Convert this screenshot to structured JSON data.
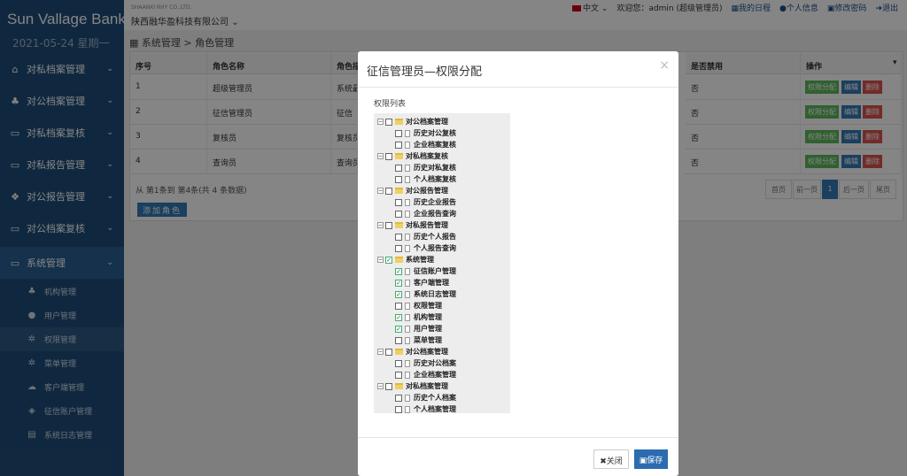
{
  "brand": "Sun Vallage Bank",
  "date": "2021-05-24 星期一",
  "company_small": "SHAANXI RHY CO.,LTD.",
  "company": "陕西融华盈科技有限公司",
  "top": {
    "lang": "中文",
    "welcome": "欢迎您：admin (超级管理员)",
    "schedule": "我的日程",
    "profile": "个人信息",
    "password": "修改密码",
    "logout": "退出"
  },
  "nav": [
    {
      "label": "对私档案管理",
      "icon": "home-icon"
    },
    {
      "label": "对公档案管理",
      "icon": "sitemap-icon"
    },
    {
      "label": "对私档案复核",
      "icon": "monitor-icon"
    },
    {
      "label": "对私报告管理",
      "icon": "laptop-icon"
    },
    {
      "label": "对公报告管理",
      "icon": "dropbox-icon"
    },
    {
      "label": "对公档案复核",
      "icon": "monitor-icon"
    },
    {
      "label": "系统管理",
      "icon": "monitor-icon"
    }
  ],
  "sub_nav": [
    {
      "label": "机构管理"
    },
    {
      "label": "用户管理"
    },
    {
      "label": "权限管理"
    },
    {
      "label": "菜单管理"
    },
    {
      "label": "客户端管理"
    },
    {
      "label": "征信账户管理"
    },
    {
      "label": "系统日志管理"
    }
  ],
  "breadcrumb": "系统管理 > 角色管理",
  "table": {
    "headers": [
      "序号",
      "角色名称",
      "角色描",
      "是否禁用",
      "操作"
    ],
    "rows": [
      {
        "no": "1",
        "name": "超级管理员",
        "desc": "系统最",
        "disabled": "否"
      },
      {
        "no": "2",
        "name": "征信管理员",
        "desc": "征信",
        "disabled": "否"
      },
      {
        "no": "3",
        "name": "复核员",
        "desc": "复核员",
        "disabled": "否"
      },
      {
        "no": "4",
        "name": "查询员",
        "desc": "查询员",
        "disabled": "否"
      }
    ],
    "actions": {
      "assign": "权限分配",
      "edit": "编辑",
      "delete": "删除"
    }
  },
  "pager": {
    "info": "从 第1条到 第4条(共 4 条数据)",
    "first": "首页",
    "prev": "前一页",
    "current": "1",
    "next": "后一页",
    "last": "尾页"
  },
  "add_role": "添加角色",
  "modal": {
    "title": "征信管理员—权限分配",
    "close_x": "×",
    "perm_label": "权限列表",
    "tree": [
      {
        "label": "对公档案管理",
        "checked": false,
        "children": [
          {
            "label": "历史对公复核",
            "checked": false
          },
          {
            "label": "企业档案复核",
            "checked": false
          }
        ]
      },
      {
        "label": "对私档案复核",
        "checked": false,
        "children": [
          {
            "label": "历史对私复核",
            "checked": false
          },
          {
            "label": "个人档案复核",
            "checked": false
          }
        ]
      },
      {
        "label": "对公报告管理",
        "checked": false,
        "children": [
          {
            "label": "历史企业报告",
            "checked": false
          },
          {
            "label": "企业报告查询",
            "checked": false
          }
        ]
      },
      {
        "label": "对私报告管理",
        "checked": false,
        "children": [
          {
            "label": "历史个人报告",
            "checked": false
          },
          {
            "label": "个人报告查询",
            "checked": false
          }
        ]
      },
      {
        "label": "系统管理",
        "checked": true,
        "children": [
          {
            "label": "征信账户管理",
            "checked": true
          },
          {
            "label": "客户端管理",
            "checked": true
          },
          {
            "label": "系统日志管理",
            "checked": true
          },
          {
            "label": "权限管理",
            "checked": false
          },
          {
            "label": "机构管理",
            "checked": true
          },
          {
            "label": "用户管理",
            "checked": true
          },
          {
            "label": "菜单管理",
            "checked": false
          }
        ]
      },
      {
        "label": "对公档案管理",
        "checked": false,
        "children": [
          {
            "label": "历史对公档案",
            "checked": false
          },
          {
            "label": "企业档案管理",
            "checked": false
          }
        ]
      },
      {
        "label": "对私档案管理",
        "checked": false,
        "children": [
          {
            "label": "历史个人档案",
            "checked": false
          },
          {
            "label": "个人档案管理",
            "checked": false
          }
        ]
      }
    ],
    "close_label": "关闭",
    "save_label": "保存"
  },
  "colors": {
    "sidebar": "#1f4e79",
    "primary": "#337ab7",
    "success": "#5cb85c",
    "danger": "#d9534f"
  }
}
